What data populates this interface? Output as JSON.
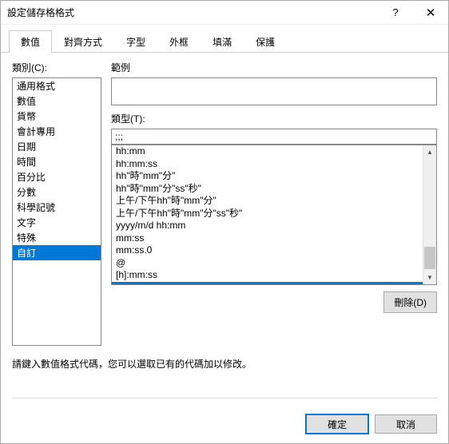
{
  "window": {
    "title": "設定儲存格格式"
  },
  "tabs": [
    {
      "label": "數值",
      "active": true
    },
    {
      "label": "對齊方式",
      "active": false
    },
    {
      "label": "字型",
      "active": false
    },
    {
      "label": "外框",
      "active": false
    },
    {
      "label": "填滿",
      "active": false
    },
    {
      "label": "保護",
      "active": false
    }
  ],
  "labels": {
    "category": "類別(C):",
    "preview": "範例",
    "type": "類型(T):",
    "delete": "刪除(D)",
    "hint": "請鍵入數值格式代碼，您可以選取已有的代碼加以修改。",
    "ok": "確定",
    "cancel": "取消"
  },
  "categories": [
    {
      "label": "通用格式",
      "selected": false
    },
    {
      "label": "數值",
      "selected": false
    },
    {
      "label": "貨幣",
      "selected": false
    },
    {
      "label": "會計專用",
      "selected": false
    },
    {
      "label": "日期",
      "selected": false
    },
    {
      "label": "時間",
      "selected": false
    },
    {
      "label": "百分比",
      "selected": false
    },
    {
      "label": "分數",
      "selected": false
    },
    {
      "label": "科學記號",
      "selected": false
    },
    {
      "label": "文字",
      "selected": false
    },
    {
      "label": "特殊",
      "selected": false
    },
    {
      "label": "自訂",
      "selected": true
    }
  ],
  "type_value": ";;;",
  "formats": [
    {
      "label": "hh:mm",
      "selected": false
    },
    {
      "label": "hh:mm:ss",
      "selected": false
    },
    {
      "label": "hh\"時\"mm\"分\"",
      "selected": false
    },
    {
      "label": "hh\"時\"mm\"分\"ss\"秒\"",
      "selected": false
    },
    {
      "label": "上午/下午hh\"時\"mm\"分\"",
      "selected": false
    },
    {
      "label": "上午/下午hh\"時\"mm\"分\"ss\"秒\"",
      "selected": false
    },
    {
      "label": "yyyy/m/d hh:mm",
      "selected": false
    },
    {
      "label": "mm:ss",
      "selected": false
    },
    {
      "label": "mm:ss.0",
      "selected": false
    },
    {
      "label": "@",
      "selected": false
    },
    {
      "label": "[h]:mm:ss",
      "selected": false
    },
    {
      "label": ";;;",
      "selected": true
    }
  ]
}
